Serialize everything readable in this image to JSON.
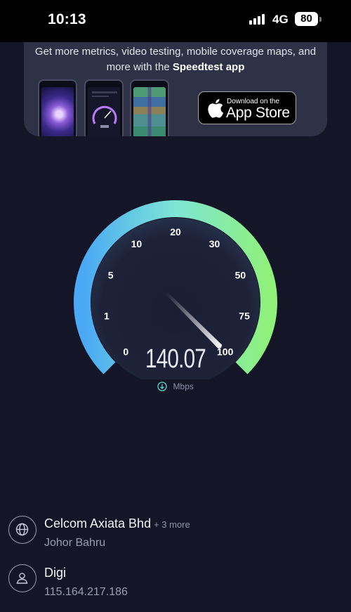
{
  "status_bar": {
    "time": "10:13",
    "network": "4G",
    "battery": "80"
  },
  "promo": {
    "text_prefix": "Get more metrics, video testing, mobile coverage maps, and more with the ",
    "app_name": "Speedtest app",
    "badge_small": "Download on the",
    "badge_big": "App Store"
  },
  "gauge": {
    "ticks": [
      "0",
      "1",
      "5",
      "10",
      "20",
      "30",
      "50",
      "75",
      "100"
    ],
    "speed": "140.07",
    "unit": "Mbps",
    "needle_value": 100,
    "colors": {
      "start": "#4aa8f5",
      "mid": "#7ee6d6",
      "end": "#8ff07a"
    }
  },
  "provider": {
    "name": "Celcom Axiata Bhd",
    "more": "+ 3 more",
    "location": "Johor Bahru",
    "icon": "globe-icon"
  },
  "client": {
    "isp": "Digi",
    "ip": "115.164.217.186",
    "icon": "user-icon"
  }
}
